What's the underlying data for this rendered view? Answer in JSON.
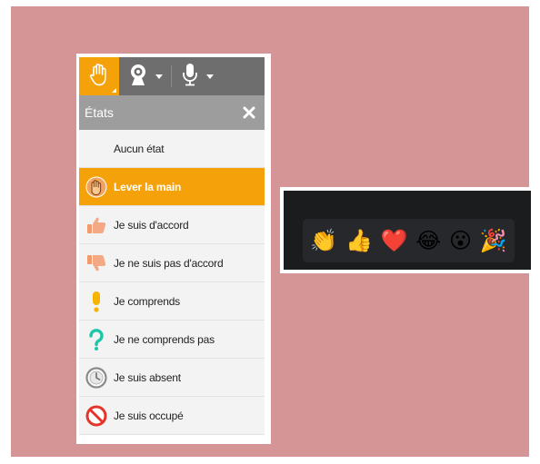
{
  "colors": {
    "background": "#d59495",
    "accent": "#f5a20a",
    "toolbar": "#6e6e6e",
    "header": "#9d9d9d",
    "reactions_bg": "#1b1c1e"
  },
  "toolbar": {
    "icons": [
      "raise-hand-icon",
      "webcam-icon",
      "microphone-icon"
    ]
  },
  "panel": {
    "title": "États",
    "close_icon": "close-icon"
  },
  "status_items": [
    {
      "label": "Aucun état",
      "icon": "none",
      "active": false
    },
    {
      "label": "Lever la main",
      "icon": "raise-hand-icon",
      "active": true
    },
    {
      "label": "Je suis d'accord",
      "icon": "thumbs-up-icon",
      "active": false
    },
    {
      "label": "Je ne suis pas d'accord",
      "icon": "thumbs-down-icon",
      "active": false
    },
    {
      "label": "Je comprends",
      "icon": "exclamation-icon",
      "active": false
    },
    {
      "label": "Je ne comprends pas",
      "icon": "question-icon",
      "active": false
    },
    {
      "label": "Je suis absent",
      "icon": "clock-icon",
      "active": false
    },
    {
      "label": "Je suis occupé",
      "icon": "no-entry-icon",
      "active": false
    }
  ],
  "reactions": [
    {
      "name": "clap-emoji",
      "glyph": "👏"
    },
    {
      "name": "thumbs-up-emoji",
      "glyph": "👍"
    },
    {
      "name": "heart-emoji",
      "glyph": "❤️"
    },
    {
      "name": "laugh-tears-emoji",
      "glyph": "😂"
    },
    {
      "name": "surprised-emoji",
      "glyph": "😮"
    },
    {
      "name": "party-popper-emoji",
      "glyph": "🎉"
    }
  ]
}
